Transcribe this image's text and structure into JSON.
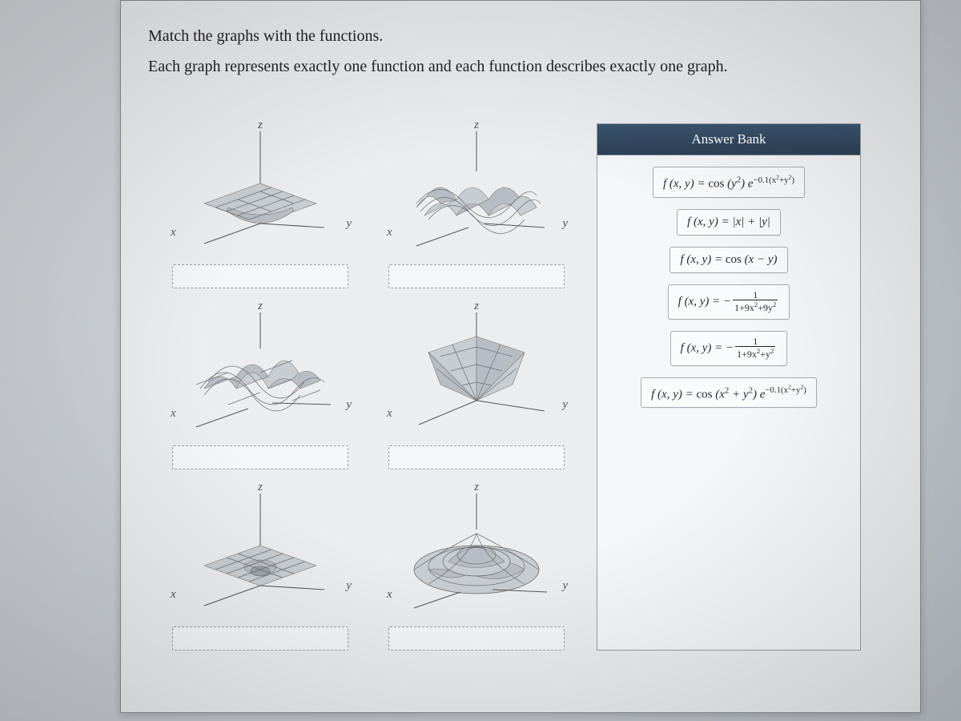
{
  "instructions": {
    "line1": "Match the graphs with the functions.",
    "line2": "Each graph represents exactly one function and each function describes exactly one graph."
  },
  "axis": {
    "x": "x",
    "y": "y",
    "z": "z"
  },
  "answer_bank": {
    "title": "Answer Bank",
    "items": [
      {
        "id": "ans1",
        "f": "f (x, y) = cos (y²) e^{−0.1(x²+y²)}"
      },
      {
        "id": "ans2",
        "f": "f (x, y) = |x| + |y|"
      },
      {
        "id": "ans3",
        "f": "f (x, y) = cos (x − y)"
      },
      {
        "id": "ans4",
        "f": "f (x, y) = − 1 / (1+9x²+9y²)"
      },
      {
        "id": "ans5",
        "f": "f (x, y) = − 1 / (1+9x²+y²)"
      },
      {
        "id": "ans6",
        "f": "f (x, y) = cos (x² + y²) e^{−0.1(x²+y²)}"
      }
    ]
  },
  "graphs": [
    {
      "id": "g1",
      "description": "flat plane with narrow elongated dip along one axis"
    },
    {
      "id": "g2",
      "description": "diagonal corrugated / wave surface"
    },
    {
      "id": "g3",
      "description": "wave ridges parallel to one axis, damped"
    },
    {
      "id": "g4",
      "description": "inverted pyramid / cone opening upward (|x|+|y|)"
    },
    {
      "id": "g5",
      "description": "flat plane with small symmetric circular dip at origin"
    },
    {
      "id": "g6",
      "description": "damped radial ripples, central dome with rings"
    }
  ]
}
